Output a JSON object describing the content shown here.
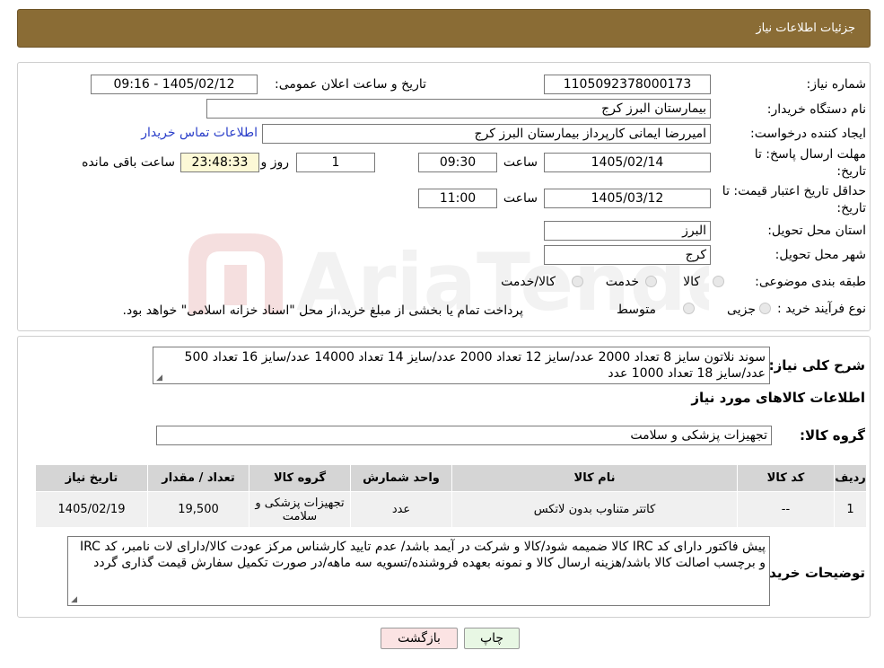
{
  "header": {
    "title": "جزئیات اطلاعات نیاز"
  },
  "form": {
    "need_number_label": "شماره نیاز:",
    "need_number": "1105092378000173",
    "announce_label": "تاریخ و ساعت اعلان عمومی:",
    "announce_value": "1405/02/12 - 09:16",
    "buyer_name_label": "نام دستگاه خریدار:",
    "buyer_name": "بیمارستان البرز کرج",
    "creator_label": "ایجاد کننده درخواست:",
    "creator": "امیررضا ایمانی کارپرداز بیمارستان البرز کرج",
    "contact_link": "اطلاعات تماس خریدار",
    "deadline_label_1": "مهلت ارسال پاسخ: تا",
    "deadline_label_2": "تاریخ:",
    "deadline_date": "1405/02/14",
    "time_label": "ساعت",
    "deadline_time": "09:30",
    "days_value": "1",
    "days_label": "روز و",
    "remaining_value": "23:48:33",
    "remaining_label": "ساعت باقی مانده",
    "validity_label_1": "حداقل تاریخ اعتبار قیمت: تا",
    "validity_label_2": "تاریخ:",
    "validity_date": "1405/03/12",
    "validity_time_label": "ساعت",
    "validity_time": "11:00",
    "province_label": "استان محل تحویل:",
    "province": "البرز",
    "city_label": "شهر محل تحویل:",
    "city": "کرج",
    "category_label": "طبقه بندی موضوعی:",
    "category_options": [
      "کالا",
      "خدمت",
      "کالا/خدمت"
    ],
    "process_label": "نوع فرآیند خرید :",
    "process_options": [
      "جزیی",
      "متوسط"
    ],
    "process_note": "پرداخت تمام یا بخشی از مبلغ خرید،از محل \"اسناد خزانه اسلامی\" خواهد بود."
  },
  "summary": {
    "label": "شرح کلی نیاز:",
    "text": "سوند نلاتون سایز 8 تعداد 2000 عدد/سایز 12 تعداد 2000 عدد/سایز 14 تعداد 14000 عدد/سایز 16 تعداد 500 عدد/سایز 18 تعداد 1000 عدد"
  },
  "goods": {
    "section_title": "اطلاعات کالاهای مورد نیاز",
    "group_label": "گروه کالا:",
    "group_value": "تجهیزات پزشکی و سلامت",
    "columns": [
      "ردیف",
      "کد کالا",
      "نام کالا",
      "واحد شمارش",
      "گروه کالا",
      "تعداد / مقدار",
      "تاریخ نیاز"
    ],
    "rows": [
      [
        "1",
        "--",
        "کاتتر متناوب بدون لاتکس",
        "عدد",
        "تجهیزات پزشکی و سلامت",
        "19,500",
        "1405/02/19"
      ]
    ]
  },
  "notes": {
    "label": "توضیحات خریدار:",
    "text": "پیش فاکتور دارای کد IRC کالا ضمیمه شود/کالا و شرکت در آیمد باشد/ عدم تایید کارشناس مرکز عودت کالا/دارای لات نامبر، کد IRC و برچسب اصالت کالا باشد/هزینه ارسال کالا و نمونه بعهده فروشنده/تسویه سه ماهه/در صورت تکمیل سفارش قیمت گذاری گردد"
  },
  "buttons": {
    "print": "چاپ",
    "back": "بازگشت"
  },
  "colors": {
    "header_bg": "#8a6c35",
    "link": "#2a3ec9",
    "remaining_bg": "#fcf8d6"
  },
  "watermark": "AriaTender.neT"
}
